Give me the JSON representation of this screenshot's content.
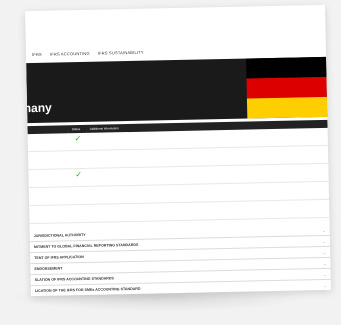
{
  "nav": {
    "items": [
      "IFRS",
      "IFRS ACCOUNTING",
      "IFRS SUSTAINABILITY"
    ]
  },
  "breadcrumb": "",
  "hero": {
    "title": "ermany"
  },
  "colors": {
    "flag_black": "#000000",
    "flag_red": "#dd0000",
    "flag_gold": "#ffce00",
    "check": "#3aa63a"
  },
  "table": {
    "headers": [
      "",
      "Status",
      "Additional Information"
    ],
    "rows": [
      {
        "req": "",
        "status_icon": "check-icon",
        "info": ""
      },
      {
        "req": "",
        "status_icon": "",
        "info": ""
      },
      {
        "req": "",
        "status_icon": "check-icon",
        "info": ""
      },
      {
        "req": "",
        "status_icon": "",
        "info": ""
      },
      {
        "req": "",
        "status_icon": "",
        "info": ""
      }
    ]
  },
  "updated": "",
  "accordion": [
    "JURISDICTIONAL AUTHORITY",
    "MITMENT TO GLOBAL FINANCIAL REPORTING STANDARDS",
    "TENT OF IFRS APPLICATION",
    "ENDORSEMENT",
    "SLATION OF IFRS ACCOUNTING STANDARDS",
    "LICATION OF THE IFRS FOR SMEs ACCOUNTING STANDARD"
  ]
}
